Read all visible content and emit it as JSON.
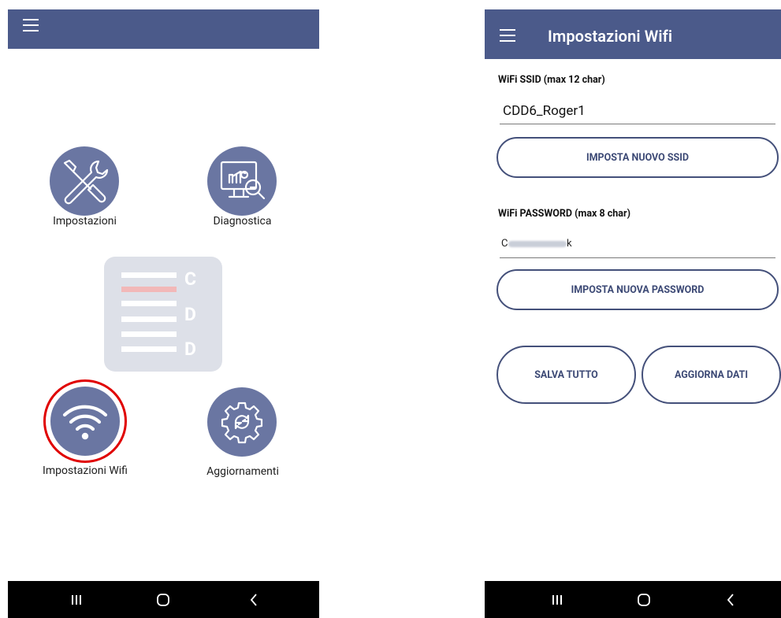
{
  "left_screen": {
    "menu_icon": "hamburger-menu-icon",
    "tiles": [
      {
        "label": "Impostazioni",
        "icon": "tools-icon"
      },
      {
        "label": "Diagnostica",
        "icon": "monitor-diagnostics-icon"
      },
      {
        "label": "Impostazioni Wifi",
        "icon": "wifi-icon",
        "highlighted": true
      },
      {
        "label": "Aggiornamenti",
        "icon": "gear-update-icon"
      }
    ],
    "logo": {
      "letters": [
        "C",
        "D",
        "D"
      ]
    }
  },
  "right_screen": {
    "title": "Impostazioni Wifi",
    "ssid": {
      "label": "WiFi SSID (max 12 char)",
      "value": "CDD6_Roger1",
      "button": "IMPOSTA NUOVO SSID"
    },
    "password": {
      "label": "WiFi PASSWORD (max 8 char)",
      "value": "C",
      "value_tail": "k",
      "button": "IMPOSTA NUOVA PASSWORD"
    },
    "actions": {
      "save": "SALVA TUTTO",
      "refresh": "AGGIORNA DATI"
    }
  },
  "nav_bar": {
    "icons": [
      "recent-apps-icon",
      "home-icon",
      "back-icon"
    ]
  },
  "colors": {
    "primary": "#4b5a8a",
    "tile": "#6a76a2",
    "highlight_ring": "#e00000",
    "logo_red": "#f2b8b8",
    "logo_gray": "#dde0e8"
  }
}
